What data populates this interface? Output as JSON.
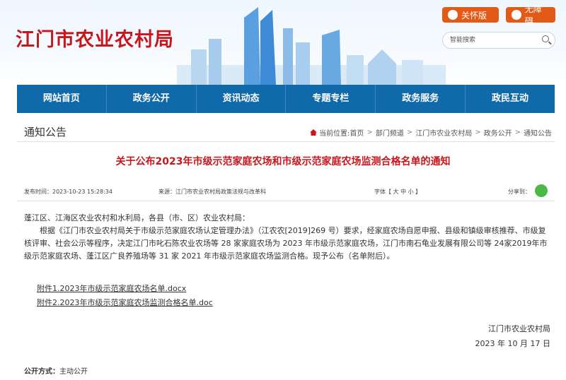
{
  "header": {
    "site_title": "江门市农业农村局",
    "care_button": "关怀版",
    "access_button": "无障碍",
    "search_placeholder": "智能搜索"
  },
  "nav": {
    "items": [
      "网站首页",
      "政务公开",
      "资讯动态",
      "专题专栏",
      "政务服务",
      "政民互动"
    ]
  },
  "breadcrumb": {
    "section_title": "通知公告",
    "prefix": "当前位置:",
    "items": [
      "首页",
      "部门频道",
      "江门市农业农村局",
      "政务公开",
      "通知公告"
    ]
  },
  "article": {
    "title": "关于公布2023年市级示范家庭农场和市级示范家庭农场监测合格名单的通知",
    "publish_time": "发布时间：2023-10-23 15:28:34",
    "source": "来源：江门市农业农村局政策法规与改革科",
    "font_size": "字体【 大  中  小 】",
    "share": "分享到：",
    "greeting": "蓬江区、江海区农业农村和水利局，各县（市、区）农业农村局：",
    "body": "根据《江门市农业农村局关于市级示范家庭农场认定管理办法》（江农农[2019]269 号）要求，经家庭农场自愿申报、县级和镇级审核推荐、市级复核评审、社会公示等程序，决定江门市叱石陈农业农场等 28 家家庭农场为 2023 年市级示范家庭农场，江门市南石龟业发展有限公司等 24家2019年市级示范家庭农场、蓬江区广良养殖场等 31 家 2021 年市级示范家庭农场监测合格。现予公布（名单附后）。",
    "attachments": [
      "附件1.2023年市级示范家庭农场名单.docx",
      "附件2.2023年市级示范家庭农场监测合格名单.doc"
    ],
    "signature": "江门市农业农村局",
    "date": "2023 年 10 月 17 日",
    "disclosure_label": "公开方式：",
    "disclosure_value": "主动公开"
  },
  "colors": {
    "brand_red": "#c8161d",
    "nav_blue": "#106aa9",
    "button_orange": "#e35a16"
  }
}
